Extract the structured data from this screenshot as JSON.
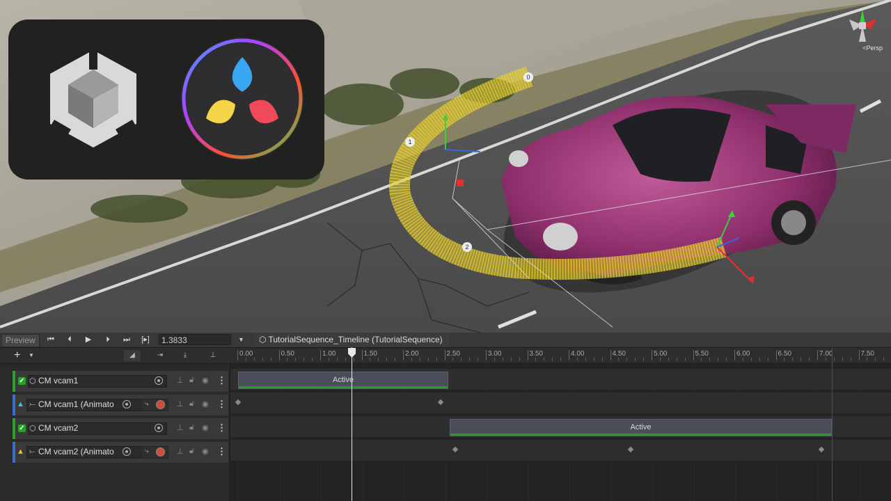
{
  "scene": {
    "gizmo_label": "<Persp",
    "waypoints": [
      "0",
      "1",
      "2"
    ]
  },
  "colors": {
    "timeline_bg": "#282828",
    "clip_active": "#1fa11f",
    "track_bar_cm": "#2fa12f",
    "track_bar_anim": "#3a6fc8",
    "record": "#d24a3a",
    "path_yellow": "#e8d030",
    "car_magenta": "#a03a7a"
  },
  "icons": {
    "first_frame": "skip-start-icon",
    "prev_frame": "step-back-icon",
    "play": "play-icon",
    "next_frame": "step-forward-icon",
    "last_frame": "skip-end-icon",
    "range": "range-icon",
    "timeline_asset": "cube-icon"
  },
  "toolbar": {
    "preview_label": "Preview",
    "range_label": "[▸]",
    "frame_value": "1.3833",
    "sequence_label": "TutorialSequence_Timeline (TutorialSequence)"
  },
  "ruler": {
    "labels": [
      "0.00",
      "0.50",
      "1.00",
      "1.50",
      "2.00",
      "2.50",
      "3.00",
      "3.50",
      "4.00",
      "4.50",
      "5.00",
      "5.50",
      "6.00",
      "6.50",
      "7.00",
      "7.50"
    ]
  },
  "tracks": [
    {
      "name": "CM vcam1",
      "type": "cinemachine",
      "clip_label": "Active"
    },
    {
      "name": "CM vcam1 (Animato",
      "type": "animation",
      "warning": false
    },
    {
      "name": "CM vcam2",
      "type": "cinemachine",
      "clip_label": "Active"
    },
    {
      "name": "CM vcam2 (Animato",
      "type": "animation",
      "warning": true
    }
  ]
}
